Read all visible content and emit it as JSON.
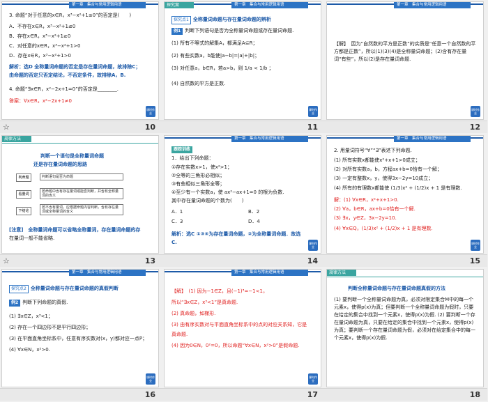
{
  "header_blue": "第一章　集合与常用逻辑用语",
  "footer_btn": "课时作业",
  "captions": [
    "10",
    "11",
    "12",
    "13",
    "14",
    "15",
    "16",
    "17",
    "18"
  ],
  "s10": {
    "l1": "3. 命题“对于任意的x∈R，x³−x²+1≤0”的否定是(　　)",
    "a": "A．不存在x∈R，x³−x²+1≤0",
    "b": "B．存在x∈R，x³−x²+1≥0",
    "c": "C．对任意的x∈R，x³−x²+1>0",
    "d": "D．存在x∈R，x³−x²+1>0",
    "j1": "解析：选D 全称量词命题的否定是存在量词命题，故排除C；",
    "j2": "由命题的否定只否定结论，不否定条件，故排除A，B.",
    "q4": "4. 命题“∃x∈R，x²−2x+1=0”的否定是________.",
    "ans": "答案：∀x∈R，x²−2x+1≠0"
  },
  "s11": {
    "tab": "探究案",
    "pt": "探究点1",
    "title": "全称量词命题与存在量词命题的辨析",
    "ex": "例1",
    "q": "判断下列语句是否为全称量词命题或存在量词命题.",
    "i1": "(1) 所有不等式的解集A，都满足A⊆R；",
    "i2": "(2) 有些实数a，b能使|a−b|=|a|+|b|；",
    "i3": "(3) 对任意a，b∈R，若a>b，则 1/a < 1/b ；",
    "i4": "(4) 自然数的平方是正数."
  },
  "s12": {
    "p": "【解】　因为“自然数的平方是正数”的实质是“任意一个自然数的平方都是正数”，所以(1)(3)(4)是全称量词命题；(2)含有存在量词“有些”，所以(2)是存在量词命题."
  },
  "s13": {
    "tag": "规律方法",
    "t1": "判断一个语句是全称量词命题",
    "t2": "还是存在量词命题的思路",
    "b1": "判断语句是否为命题",
    "b2": "若命题中含有存在量词或能否判断，并含有全称量词的含义",
    "b3": "若不含有量词，应根据命题内容判断，含有存在量词或全称量词的含义",
    "d1": "判命题",
    "d2": "看量词",
    "d3": "下结论",
    "n1": "[注意]　全称量词命题可以省略全称量词，存在量词命题的存",
    "n2": "在量词一般不能省略."
  },
  "s14": {
    "tag": "跟踪训练",
    "l1": "1．给出下列命题：",
    "l2": "①存在实数x>1，使x²>1；",
    "l3": "②全等的三角形必相似；",
    "l4": "③有些相似三角形全等；",
    "l5": "④至少有一个实数a，使 ax²−ax+1=0 的根为负数.",
    "l6": "其中存在量词命题的个数为(　　)",
    "a": "A．1",
    "b": "B．2",
    "c": "C．3",
    "d": "D．4",
    "j1": "解析：选C ①③④为存在量词命题，②为全称量词命题．故选",
    "j2": "C."
  },
  "s15": {
    "l0": "2. 用量词符号“∀”“∃”表述下列命题.",
    "l1": "(1) 所有实数x都能使x²+x+1>0成立；",
    "l2": "(2) 对所有实数a，b，方程ax+b=0恰有一个解；",
    "l3": "(3) 一定有整数x，y，使得3x−2y=10成立；",
    "l4": "(4) 所有的有理数x都能使 (1/3)x² + (1/2)x + 1 是有理数.",
    "a0": "解：(1) ∀x∈R，x²+x+1>0.",
    "a1": "(2) ∀a，b∈R，ax+b=0恰有一个解.",
    "a2": "(3) ∃x，y∈Z，3x−2y=10.",
    "a3": "(4) ∀x∈Q，(1/3)x² + (1/2)x + 1 是有理数."
  },
  "s16": {
    "pt": "探究点2",
    "title1": "全称量词命题与存在量词命题的真假判断",
    "ex": "例2",
    "q": "判断下列命题的真假.",
    "i1": "(1) ∃x∈Z，x³<1；",
    "i2": "(2) 存在一个四边形不是平行四边形；",
    "i3": "(3) 在平面直角坐标系中，任意有序实数对(x，y)都对应一点P；",
    "i4": "(4) ∀x∈N，x²>0."
  },
  "s17": {
    "l1": "【解】　(1) 因为−1∈Z，且(−1)³=−1<1，",
    "l2": "所以“∃x∈Z，x³<1”是真命题.",
    "l3": "(2) 真命题，如梯形.",
    "l4": "(3) 由有序实数对与平面直角坐标系中的点的对应关系知，它是",
    "l5": "真命题.",
    "l6": "(4) 因为0∈N，0²=0，所以命题“∀x∈N，x²>0”是假命题."
  },
  "s18": {
    "tag": "规律方法",
    "title": "判断全称量词命题与存在量词命题真假的方法",
    "p": "(1) 要判断一个全称量词命题为真，必须对限定集合M中的每一个元素x，使得p(x)为真；但要判断一个全称量词命题为假时，只要在给定的集合中找到一个元素x，使得p(x)为假. (2) 要判断一个存在量词命题为真，只要在给定的集合中找到一个元素x，使得p(x)为真；要判断一个存在量词命题为假，必须对在给定集合中的每一个元素x，使得p(x)为假."
  }
}
